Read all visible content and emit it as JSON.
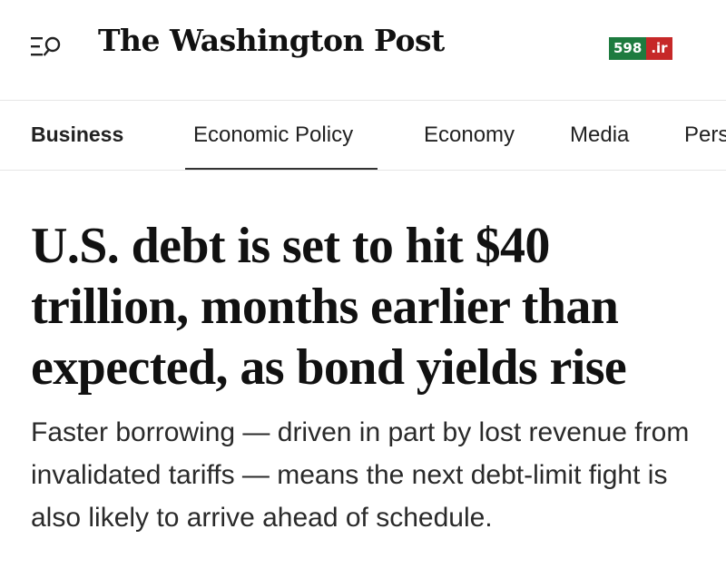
{
  "header": {
    "menu_icon": "hamburger-search-icon",
    "masthead": "The Washington Post",
    "badge": {
      "number": "598",
      "tld": ".ir",
      "number_color": "#1e7b3f",
      "tld_color": "#c62828"
    }
  },
  "nav": {
    "items": [
      {
        "label": "Business"
      },
      {
        "label": "Economic Policy"
      },
      {
        "label": "Economy"
      },
      {
        "label": "Media"
      },
      {
        "label": "Pers"
      }
    ]
  },
  "article": {
    "headline": "U.S. debt is set to hit $40 trillion, months earlier than expected, as bond yields rise",
    "dek": "Faster borrowing — driven in part by lost revenue from invalidated tariffs — means the next debt-limit fight is also likely to arrive ahead of schedule."
  }
}
